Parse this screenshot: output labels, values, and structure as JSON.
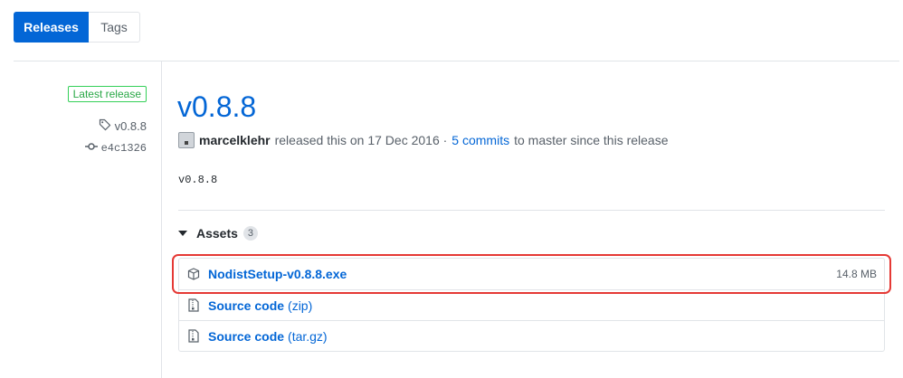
{
  "tabs": [
    {
      "label": "Releases",
      "selected": true
    },
    {
      "label": "Tags",
      "selected": false
    }
  ],
  "sidebar": {
    "latest_label": "Latest release",
    "tag_name": "v0.8.8",
    "commit_sha": "e4c1326"
  },
  "release": {
    "title": "v0.8.8",
    "author": "marcelklehr",
    "released_text": "released this on 17 Dec 2016 ·",
    "commits_link": "5 commits",
    "commits_suffix": "to master since this release",
    "body": "v0.8.8"
  },
  "assets": {
    "label": "Assets",
    "count": "3",
    "items": [
      {
        "name": "NodistSetup-v0.8.8.exe",
        "paren": "",
        "size": "14.8 MB",
        "icon": "package-icon"
      },
      {
        "name": "Source code",
        "paren": "(zip)",
        "size": "",
        "icon": "file-zip-icon"
      },
      {
        "name": "Source code",
        "paren": "(tar.gz)",
        "size": "",
        "icon": "file-zip-icon"
      }
    ]
  },
  "colors": {
    "accent": "#0366d6",
    "latest": "#28a745",
    "highlight": "#e53935"
  }
}
